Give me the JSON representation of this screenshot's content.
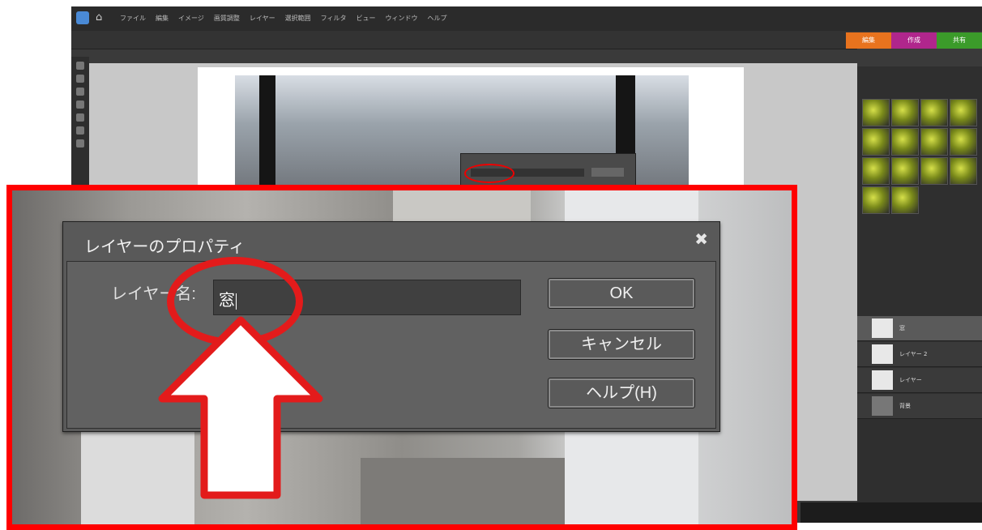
{
  "background_app": {
    "menus": [
      "ファイル",
      "編集",
      "イメージ",
      "画質調整",
      "レイヤー",
      "選択範囲",
      "フィルタ",
      "ビュー",
      "ウィンドウ",
      "ヘルプ"
    ],
    "mode_tabs": [
      {
        "label": "編集",
        "color": "#e8731e"
      },
      {
        "label": "作成",
        "color": "#b0268c"
      },
      {
        "label": "共有",
        "color": "#3b9b2a"
      }
    ],
    "layers": [
      "窓",
      "レイヤー 2",
      "レイヤー",
      "背景"
    ]
  },
  "dialog": {
    "title": "レイヤーのプロパティ",
    "close_glyph": "✖",
    "name_label": "レイヤー名:",
    "name_value": "窓",
    "ok_label": "OK",
    "cancel_label": "キャンセル",
    "help_label": "ヘルプ(H)"
  },
  "annotation": {
    "highlight_color": "#ff0000",
    "circle_color": "#e31b1b",
    "arrow_fill": "#ffffff",
    "arrow_stroke": "#e31b1b"
  }
}
